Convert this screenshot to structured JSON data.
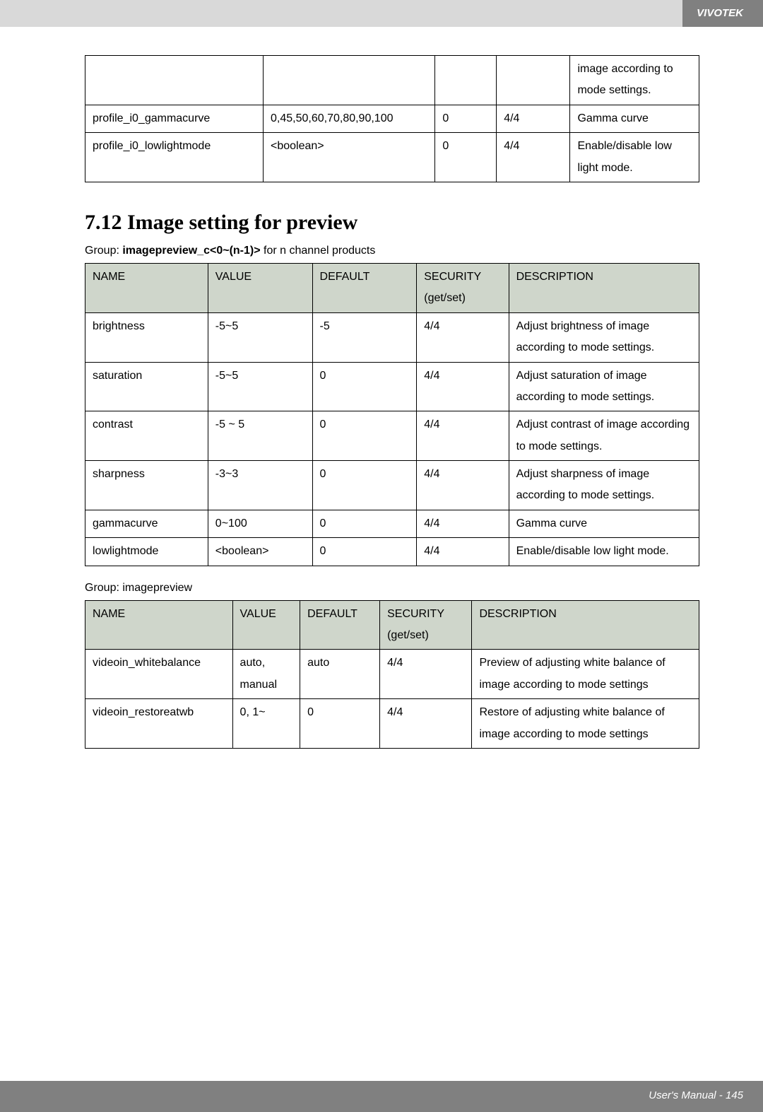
{
  "brand": "VIVOTEK",
  "table1": {
    "rows": [
      {
        "name": "",
        "value": "",
        "default": "",
        "security": "",
        "desc": "image according to mode settings."
      },
      {
        "name": "profile_i0_gammacurve",
        "value": "0,45,50,60,70,80,90,100",
        "default": "0",
        "security": "4/4",
        "desc": "Gamma curve"
      },
      {
        "name": "profile_i0_lowlightmode",
        "value": "<boolean>",
        "default": "0",
        "security": "4/4",
        "desc": "Enable/disable low light mode."
      }
    ]
  },
  "section_title": "7.12 Image setting for preview",
  "group2": {
    "prefix": "Group: ",
    "bold": "imagepreview_c<0~(n-1)>",
    "suffix": " for n channel products"
  },
  "table2": {
    "headers": [
      "NAME",
      "VALUE",
      "DEFAULT",
      "SECURITY (get/set)",
      "DESCRIPTION"
    ],
    "rows": [
      {
        "name": "brightness",
        "value": "-5~5",
        "default": "-5",
        "security": "4/4",
        "desc": "Adjust brightness of image according to mode settings."
      },
      {
        "name": "saturation",
        "value": "-5~5",
        "default": "0",
        "security": "4/4",
        "desc": "Adjust saturation of image according to mode settings."
      },
      {
        "name": "contrast",
        "value": "-5 ~ 5",
        "default": "0",
        "security": "4/4",
        "desc": "Adjust contrast of image according to mode settings."
      },
      {
        "name": "sharpness",
        "value": "-3~3",
        "default": "0",
        "security": "4/4",
        "desc": "Adjust sharpness of image according to mode settings."
      },
      {
        "name": "gammacurve",
        "value": "0~100",
        "default": "0",
        "security": "4/4",
        "desc": "Gamma curve"
      },
      {
        "name": "lowlightmode",
        "value": "<boolean>",
        "default": "0",
        "security": "4/4",
        "desc": "Enable/disable low light mode."
      }
    ]
  },
  "group3": "Group: imagepreview",
  "table3": {
    "headers": [
      "NAME",
      "VALUE",
      "DEFAULT",
      "SECURITY (get/set)",
      "DESCRIPTION"
    ],
    "rows": [
      {
        "name": "videoin_whitebalance",
        "value": "auto, manual",
        "default": "auto",
        "security": "4/4",
        "desc": "Preview of adjusting white balance of image according to mode settings"
      },
      {
        "name": "videoin_restoreatwb",
        "value": "0, 1~",
        "default": "0",
        "security": "4/4",
        "desc": "Restore of adjusting white balance of image according to mode settings"
      }
    ]
  },
  "footer": "User's Manual - 145"
}
